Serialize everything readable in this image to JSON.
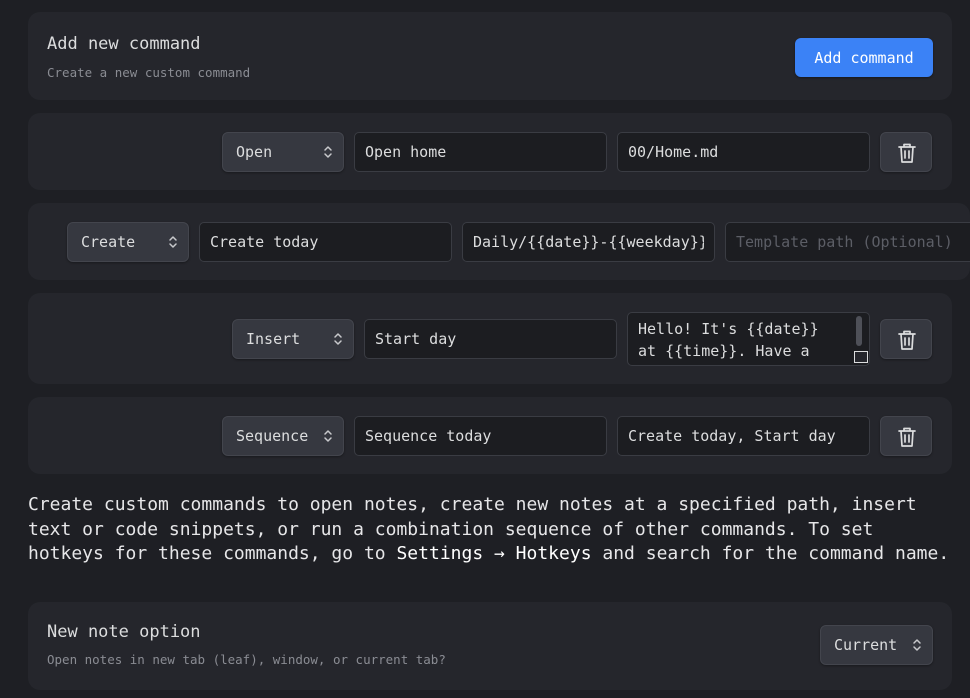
{
  "add_section": {
    "title": "Add new command",
    "description": "Create a new custom command",
    "button_label": "Add command"
  },
  "commands": [
    {
      "type": "Open",
      "name": "Open home",
      "path": "00/Home.md"
    },
    {
      "type": "Create",
      "name": "Create today",
      "path": "Daily/{{date}}-{{weekday}}",
      "template_placeholder": "Template path (Optional)"
    },
    {
      "type": "Insert",
      "name": "Start day",
      "text": "Hello! It's {{date}}\nat {{time}}. Have a\ngreat day!"
    },
    {
      "type": "Sequence",
      "name": "Sequence today",
      "sequence": "Create today, Start day"
    }
  ],
  "info": {
    "text_before": "Create custom commands to open notes, create new notes at a specified path, insert text or code snippets, or run a combination sequence of other commands. To set hotkeys for these commands, go to ",
    "settings_path": "Settings → Hotkeys",
    "text_after": " and search for the command name."
  },
  "new_note_option": {
    "title": "New note option",
    "description": "Open notes in new tab (leaf), window, or current tab?",
    "selected": "Current"
  },
  "colors": {
    "background": "#1e1f24",
    "card": "#25262c",
    "accent": "#3b82f6",
    "text": "#dcddde",
    "muted": "#8a8c93"
  }
}
